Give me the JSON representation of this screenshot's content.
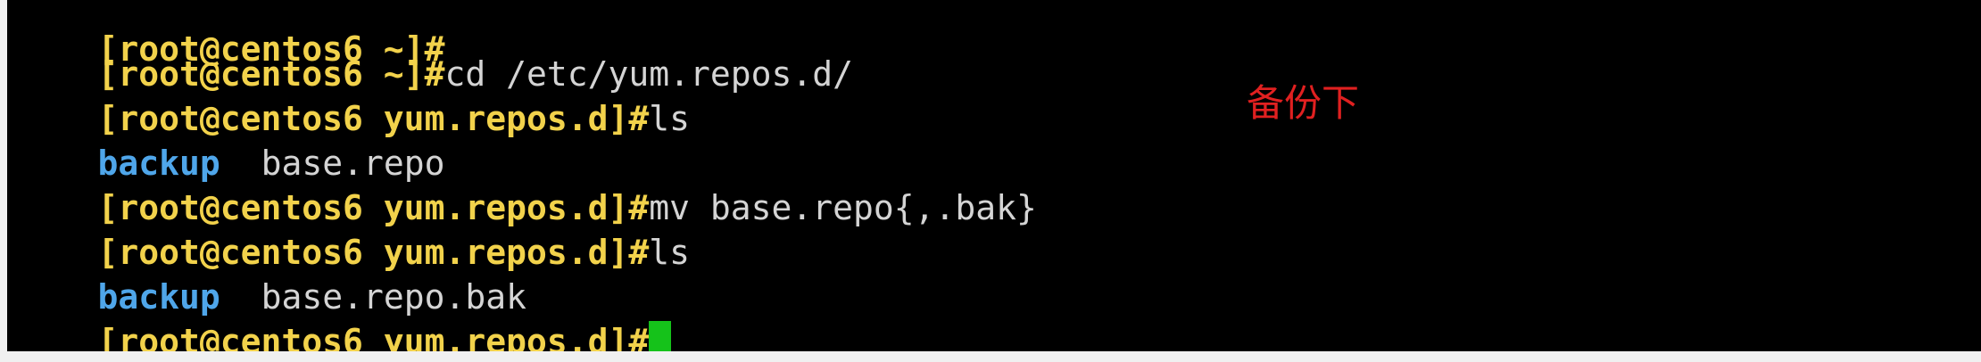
{
  "terminal": {
    "lines": [
      {
        "prompt": "[root@centos6 ~]",
        "hash": "#",
        "command": ""
      },
      {
        "prompt": "[root@centos6 ~]",
        "hash": "#",
        "command": "cd /etc/yum.repos.d/"
      },
      {
        "prompt": "[root@centos6 yum.repos.d]",
        "hash": "#",
        "command": "ls"
      },
      {
        "dir": "backup",
        "sep": "  ",
        "file": "base.repo"
      },
      {
        "prompt": "[root@centos6 yum.repos.d]",
        "hash": "#",
        "command": "mv base.repo{,.bak}"
      },
      {
        "prompt": "[root@centos6 yum.repos.d]",
        "hash": "#",
        "command": "ls"
      },
      {
        "dir": "backup",
        "sep": "  ",
        "file": "base.repo.bak"
      },
      {
        "prompt": "[root@centos6 yum.repos.d]",
        "hash": "#",
        "command": ""
      }
    ]
  },
  "annotation": {
    "text": "备份下",
    "color": "#e02020"
  },
  "colors": {
    "background": "#000000",
    "prompt": "#f2d24b",
    "directory": "#4fa6ea",
    "text": "#d4d4d4",
    "cursor": "#15c21a"
  }
}
